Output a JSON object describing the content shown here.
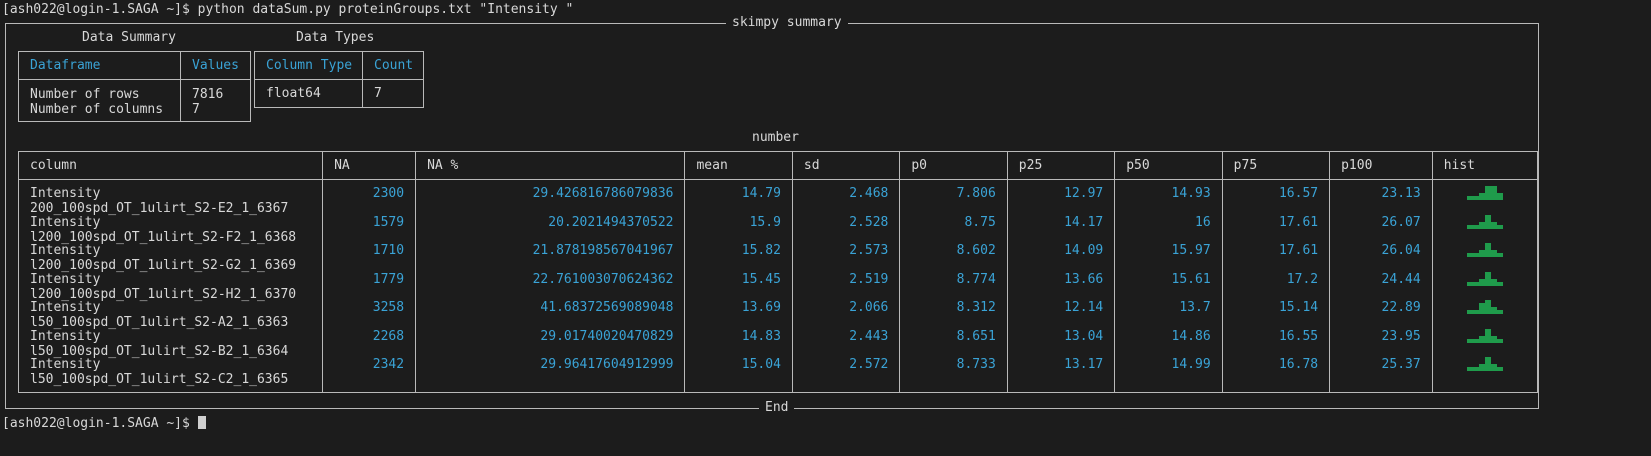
{
  "terminal": {
    "command_prompt": "[ash022@login-1.SAGA ~]$ python dataSum.py proteinGroups.txt \"Intensity \"",
    "final_prompt": "[ash022@login-1.SAGA ~]$ "
  },
  "summary": {
    "title": "skimpy summary",
    "end_label": "End",
    "data_summary": {
      "caption": "Data Summary",
      "headers": [
        "Dataframe",
        "Values"
      ],
      "rows": [
        [
          "Number of rows",
          "7816"
        ],
        [
          "Number of columns",
          "7"
        ]
      ]
    },
    "data_types": {
      "caption": "Data Types",
      "headers": [
        "Column Type",
        "Count"
      ],
      "rows": [
        [
          "float64",
          "7"
        ]
      ]
    },
    "number": {
      "caption": "number",
      "headers": [
        "column",
        "NA",
        "NA %",
        "mean",
        "sd",
        "p0",
        "p25",
        "p50",
        "p75",
        "p100",
        "hist"
      ],
      "rows": [
        {
          "name1": "Intensity",
          "name2": "200_100spd_OT_1ulirt_S2-E2_1_6367",
          "na": "2300",
          "na_pct": "29.426816786079836",
          "mean": "14.79",
          "sd": "2.468",
          "p0": "7.806",
          "p25": "12.97",
          "p50": "14.93",
          "p75": "16.57",
          "p100": "23.13",
          "hist": [
            1,
            1,
            2,
            4,
            4,
            2
          ]
        },
        {
          "name1": "Intensity",
          "name2": "l200_100spd_OT_1ulirt_S2-F2_1_6368",
          "na": "1579",
          "na_pct": "20.2021494370522",
          "mean": "15.9",
          "sd": "2.528",
          "p0": "8.75",
          "p25": "14.17",
          "p50": "16",
          "p75": "17.61",
          "p100": "26.07",
          "hist": [
            1,
            1,
            2,
            4,
            2,
            1
          ]
        },
        {
          "name1": "Intensity",
          "name2": "l200_100spd_OT_1ulirt_S2-G2_1_6369",
          "na": "1710",
          "na_pct": "21.878198567041967",
          "mean": "15.82",
          "sd": "2.573",
          "p0": "8.602",
          "p25": "14.09",
          "p50": "15.97",
          "p75": "17.61",
          "p100": "26.04",
          "hist": [
            1,
            1,
            2,
            4,
            2,
            1
          ]
        },
        {
          "name1": "Intensity",
          "name2": "l200_100spd_OT_1ulirt_S2-H2_1_6370",
          "na": "1779",
          "na_pct": "22.761003070624362",
          "mean": "15.45",
          "sd": "2.519",
          "p0": "8.774",
          "p25": "13.66",
          "p50": "15.61",
          "p75": "17.2",
          "p100": "24.44",
          "hist": [
            1,
            1,
            2,
            4,
            2,
            1
          ]
        },
        {
          "name1": "Intensity",
          "name2": "l50_100spd_OT_1ulirt_S2-A2_1_6363",
          "na": "3258",
          "na_pct": "41.68372569089048",
          "mean": "13.69",
          "sd": "2.066",
          "p0": "8.312",
          "p25": "12.14",
          "p50": "13.7",
          "p75": "15.14",
          "p100": "22.89",
          "hist": [
            1,
            1,
            3,
            4,
            2,
            1
          ]
        },
        {
          "name1": "Intensity",
          "name2": "l50_100spd_OT_1ulirt_S2-B2_1_6364",
          "na": "2268",
          "na_pct": "29.01740020470829",
          "mean": "14.83",
          "sd": "2.443",
          "p0": "8.651",
          "p25": "13.04",
          "p50": "14.86",
          "p75": "16.55",
          "p100": "23.95",
          "hist": [
            1,
            1,
            2,
            4,
            2,
            1
          ]
        },
        {
          "name1": "Intensity",
          "name2": "l50_100spd_OT_1ulirt_S2-C2_1_6365",
          "na": "2342",
          "na_pct": "29.96417604912999",
          "mean": "15.04",
          "sd": "2.572",
          "p0": "8.733",
          "p25": "13.17",
          "p50": "14.99",
          "p75": "16.78",
          "p100": "25.37",
          "hist": [
            1,
            1,
            2,
            4,
            2,
            1
          ]
        }
      ]
    }
  }
}
